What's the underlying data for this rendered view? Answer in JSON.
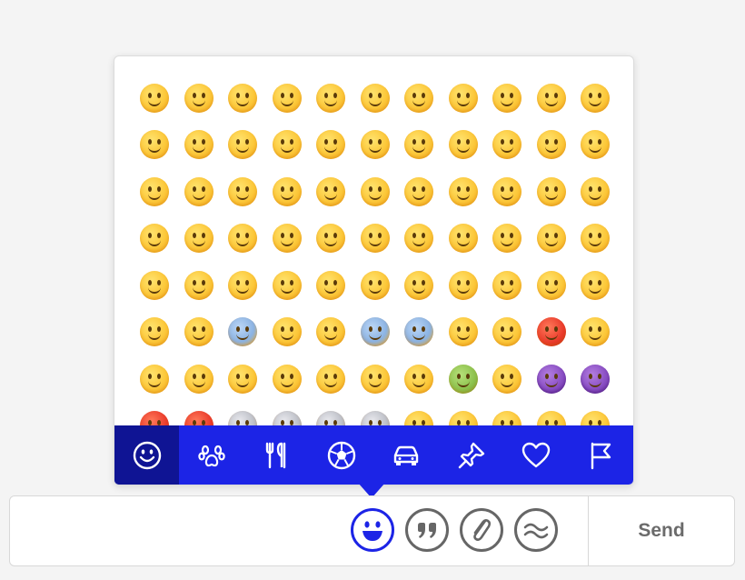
{
  "emoji_picker": {
    "rows": [
      [
        "😀",
        "😁",
        "😂",
        "🤣",
        "😃",
        "😄",
        "😅",
        "😆",
        "😉",
        "😊",
        "😋"
      ],
      [
        "😎",
        "😍",
        "😘",
        "😗",
        "😙",
        "😚",
        "☺️",
        "🙂",
        "🤗",
        "🤔",
        "😐"
      ],
      [
        "😑",
        "😶",
        "🙄",
        "😏",
        "😣",
        "😥",
        "😮",
        "🤐",
        "😯",
        "😪",
        "😫"
      ],
      [
        "😴",
        "😌",
        "🤓",
        "😛",
        "😜",
        "😝",
        "🤤",
        "😒",
        "😓",
        "😔",
        "😕"
      ],
      [
        "🙃",
        "🤑",
        "😲",
        "☹️",
        "🙁",
        "😖",
        "😞",
        "😟",
        "😤",
        "😢",
        "😭"
      ],
      [
        "😦",
        "😧",
        "😨",
        "😩",
        "😬",
        "😰",
        "😱",
        "😳",
        "😵",
        "😡",
        "😠"
      ],
      [
        "😇",
        "🤠",
        "🤡",
        "🤥",
        "😷",
        "🤒",
        "🤕",
        "🤢",
        "🤧",
        "😈",
        "👿"
      ],
      [
        "👹",
        "👺",
        "💀",
        "👻",
        "👽",
        "🤖",
        "💩",
        "😺",
        "😸",
        "😹",
        "😻"
      ]
    ],
    "categories": [
      {
        "name": "smileys",
        "icon": "smiley-icon",
        "active": true
      },
      {
        "name": "animals",
        "icon": "paw-icon",
        "active": false
      },
      {
        "name": "food",
        "icon": "fork-knife-icon",
        "active": false
      },
      {
        "name": "activities",
        "icon": "soccer-ball-icon",
        "active": false
      },
      {
        "name": "travel",
        "icon": "car-icon",
        "active": false
      },
      {
        "name": "objects",
        "icon": "pushpin-icon",
        "active": false
      },
      {
        "name": "symbols",
        "icon": "heart-icon",
        "active": false
      },
      {
        "name": "flags",
        "icon": "flag-icon",
        "active": false
      }
    ]
  },
  "composer": {
    "send_label": "Send",
    "buttons": [
      {
        "name": "emoji",
        "icon": "smiley-icon",
        "active": true
      },
      {
        "name": "quote",
        "icon": "quote-icon",
        "active": false
      },
      {
        "name": "attach",
        "icon": "paperclip-icon",
        "active": false
      },
      {
        "name": "gif",
        "icon": "waves-icon",
        "active": false
      }
    ]
  },
  "colors": {
    "accent": "#1c24e6",
    "accent_dark": "#0f1494",
    "icon_gray": "#666666",
    "send_text": "#6b6b6b"
  }
}
